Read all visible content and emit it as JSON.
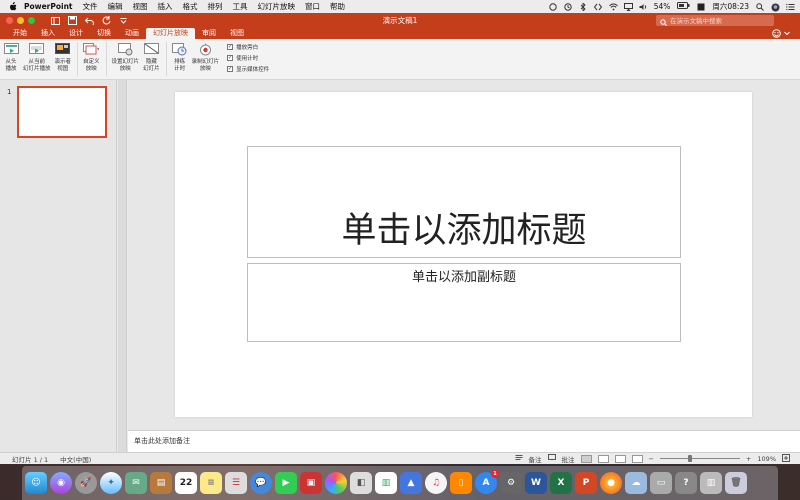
{
  "menubar": {
    "app_name": "PowerPoint",
    "items": [
      "文件",
      "编辑",
      "视图",
      "插入",
      "格式",
      "排列",
      "工具",
      "幻灯片放映",
      "窗口",
      "帮助"
    ],
    "battery": "54%",
    "clock": "周六08:23"
  },
  "window": {
    "title": "演示文稿1",
    "search_placeholder": "在演示文稿中搜索"
  },
  "ribbon_tabs": [
    "开始",
    "插入",
    "设计",
    "切换",
    "动画",
    "幻灯片放映",
    "审阅",
    "视图"
  ],
  "active_tab": "幻灯片放映",
  "ribbon": {
    "from_start": [
      "从头",
      "播放"
    ],
    "from_current": [
      "从当前",
      "幻灯片播放"
    ],
    "presenter_view": [
      "演示者",
      "视图"
    ],
    "custom_show": [
      "自定义",
      "放映"
    ],
    "setup_show": [
      "设置幻灯片",
      "放映"
    ],
    "hide_slide": [
      "隐藏",
      "幻灯片"
    ],
    "rehearse": [
      "排练",
      "计时"
    ],
    "record": [
      "录制幻灯片",
      "放映"
    ],
    "checks": [
      "播放旁白",
      "使用计时",
      "显示媒体控件"
    ]
  },
  "thumbnail": {
    "number": "1"
  },
  "slide": {
    "title_placeholder": "单击以添加标题",
    "subtitle_placeholder": "单击以添加副标题"
  },
  "notes": {
    "placeholder": "单击此处添加备注"
  },
  "statusbar": {
    "slide_count": "幻灯片 1 / 1",
    "language": "中文(中国)",
    "notes_label": "备注",
    "comments_label": "批注",
    "zoom": "109%"
  },
  "dock": {
    "calendar_day": "22",
    "appstore_badge": "1"
  },
  "colors": {
    "accent": "#c43e1c",
    "ribbon_bg": "#f3f3f3",
    "selection": "#d24726"
  }
}
